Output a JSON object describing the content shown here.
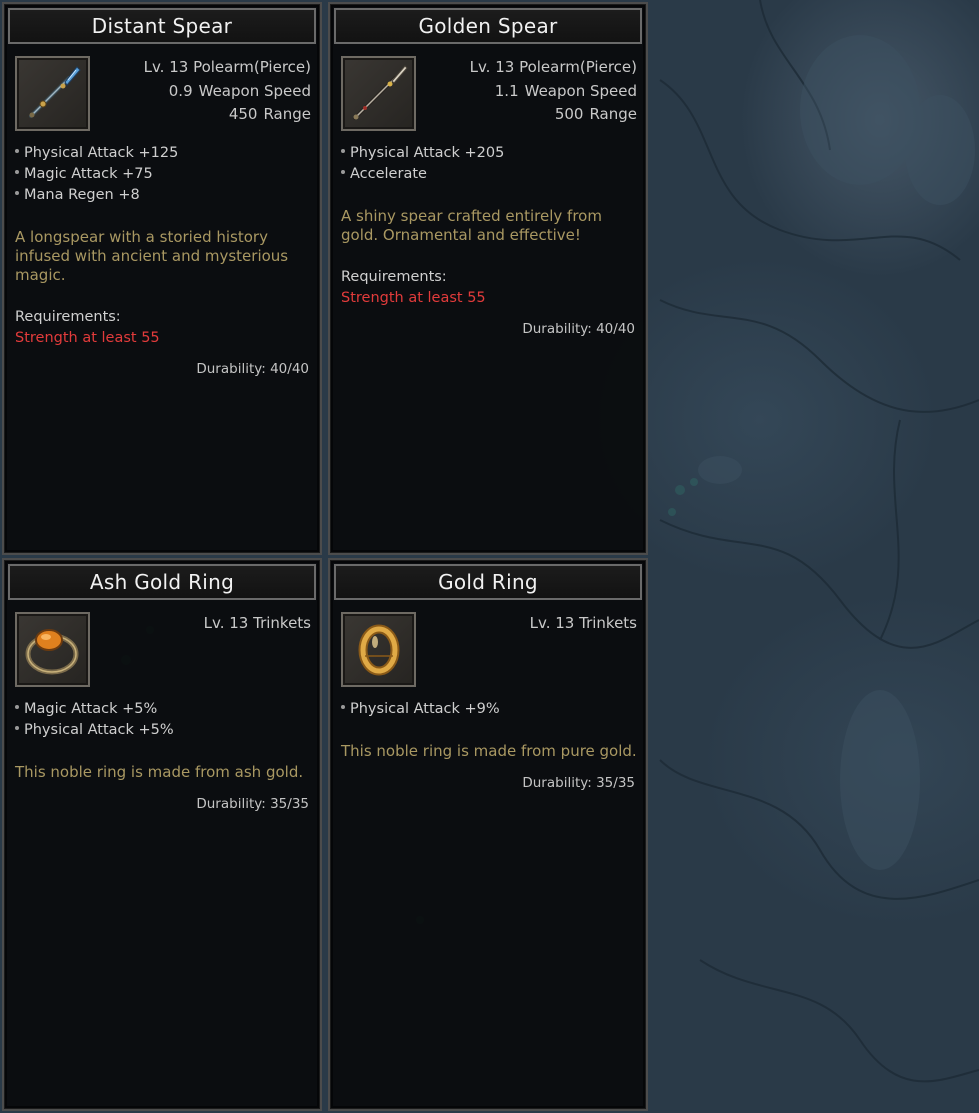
{
  "colors": {
    "title_text": "#f1f1f1",
    "description_text": "#a99862",
    "requirement_text": "#e23b3b",
    "stat_text": "#c9c9c9",
    "card_border": "#4c4c4c"
  },
  "cards": [
    {
      "title": "Distant Spear",
      "icon": "spear-blue-icon",
      "level_type": "Lv. 13 Polearm(Pierce)",
      "weapon_speed_value": "0.9",
      "weapon_speed_label": "Weapon Speed",
      "range_value": "450",
      "range_label": "Range",
      "attributes": [
        "Physical Attack +125",
        "Magic Attack +75",
        "Mana Regen +8"
      ],
      "description": "A longspear with a storied history infused with ancient and mysterious magic.",
      "requirements_label": "Requirements:",
      "requirement": "Strength at least 55",
      "durability": "Durability: 40/40"
    },
    {
      "title": "Golden Spear",
      "icon": "spear-gold-icon",
      "level_type": "Lv. 13 Polearm(Pierce)",
      "weapon_speed_value": "1.1",
      "weapon_speed_label": "Weapon Speed",
      "range_value": "500",
      "range_label": "Range",
      "attributes": [
        "Physical Attack +205",
        "Accelerate"
      ],
      "description": "A shiny spear crafted entirely from gold. Ornamental and effective!",
      "requirements_label": "Requirements:",
      "requirement": "Strength at least 55",
      "durability": "Durability: 40/40"
    },
    {
      "title": "Ash Gold Ring",
      "icon": "ring-amber-gem-icon",
      "level_type": "Lv. 13 Trinkets",
      "attributes": [
        "Magic Attack +5%",
        "Physical Attack +5%"
      ],
      "description": "This noble ring is made from ash gold.",
      "durability": "Durability: 35/35"
    },
    {
      "title": "Gold Ring",
      "icon": "ring-gold-icon",
      "level_type": "Lv. 13 Trinkets",
      "attributes": [
        "Physical Attack +9%"
      ],
      "description": "This noble ring is made from pure gold.",
      "durability": "Durability: 35/35"
    }
  ]
}
